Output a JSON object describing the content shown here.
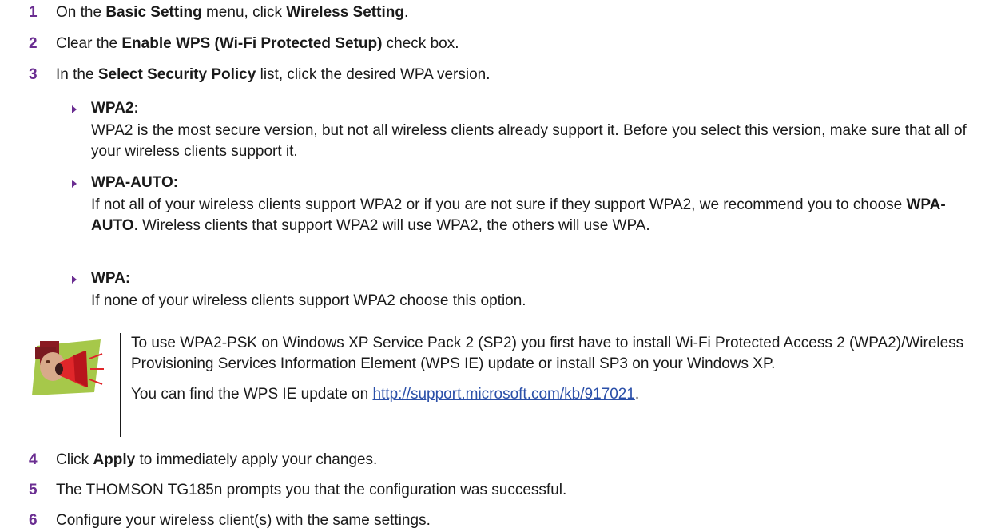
{
  "steps": [
    {
      "num": "1",
      "pre": "On the ",
      "b1": "Basic Setting",
      "mid": " menu, click ",
      "b2": "Wireless Setting",
      "post": "."
    },
    {
      "num": "2",
      "pre": "Clear the ",
      "b1": "Enable WPS (Wi-Fi Protected Setup)",
      "post": " check box."
    },
    {
      "num": "3",
      "pre": "In the ",
      "b1": "Select Security Policy",
      "post": " list, click the desired WPA version."
    },
    {
      "num": "4",
      "pre": "Click ",
      "b1": "Apply",
      "post": " to immediately apply your changes."
    },
    {
      "num": "5",
      "text": "The THOMSON TG185n prompts you that the configuration was successful."
    },
    {
      "num": "6",
      "text": "Configure your wireless client(s) with the same settings."
    }
  ],
  "options": [
    {
      "title": "WPA2",
      "colon": ":",
      "body": "WPA2 is the most secure version, but not all wireless clients already support it. Before you select this version, make sure that all of your wireless clients support it."
    },
    {
      "title": "WPA-AUTO",
      "colon": ":",
      "body_pre": "If not all of your wireless clients support WPA2 or if you are not sure if they support WPA2, we recommend you to choose ",
      "body_b": "WPA-AUTO",
      "body_post": ". Wireless clients that support WPA2 will use WPA2, the others will use WPA."
    },
    {
      "title": "WPA",
      "colon": ":",
      "body": "If none of your wireless clients support WPA2 choose this option."
    }
  ],
  "note": {
    "icon": "megaphone-icon",
    "p1": "To use WPA2-PSK on Windows XP Service Pack 2 (SP2) you first have to install Wi-Fi Protected Access 2 (WPA2)/Wireless Provisioning Services Information Element (WPS IE) update or install SP3 on your Windows XP.",
    "p2_pre": "You can find the WPS IE update on ",
    "p2_link": "http://support.microsoft.com/kb/917021",
    "p2_post": "."
  },
  "colors": {
    "accent": "#6a2d91",
    "link": "#2a4fa8",
    "note_bg": "#a6c84a"
  }
}
